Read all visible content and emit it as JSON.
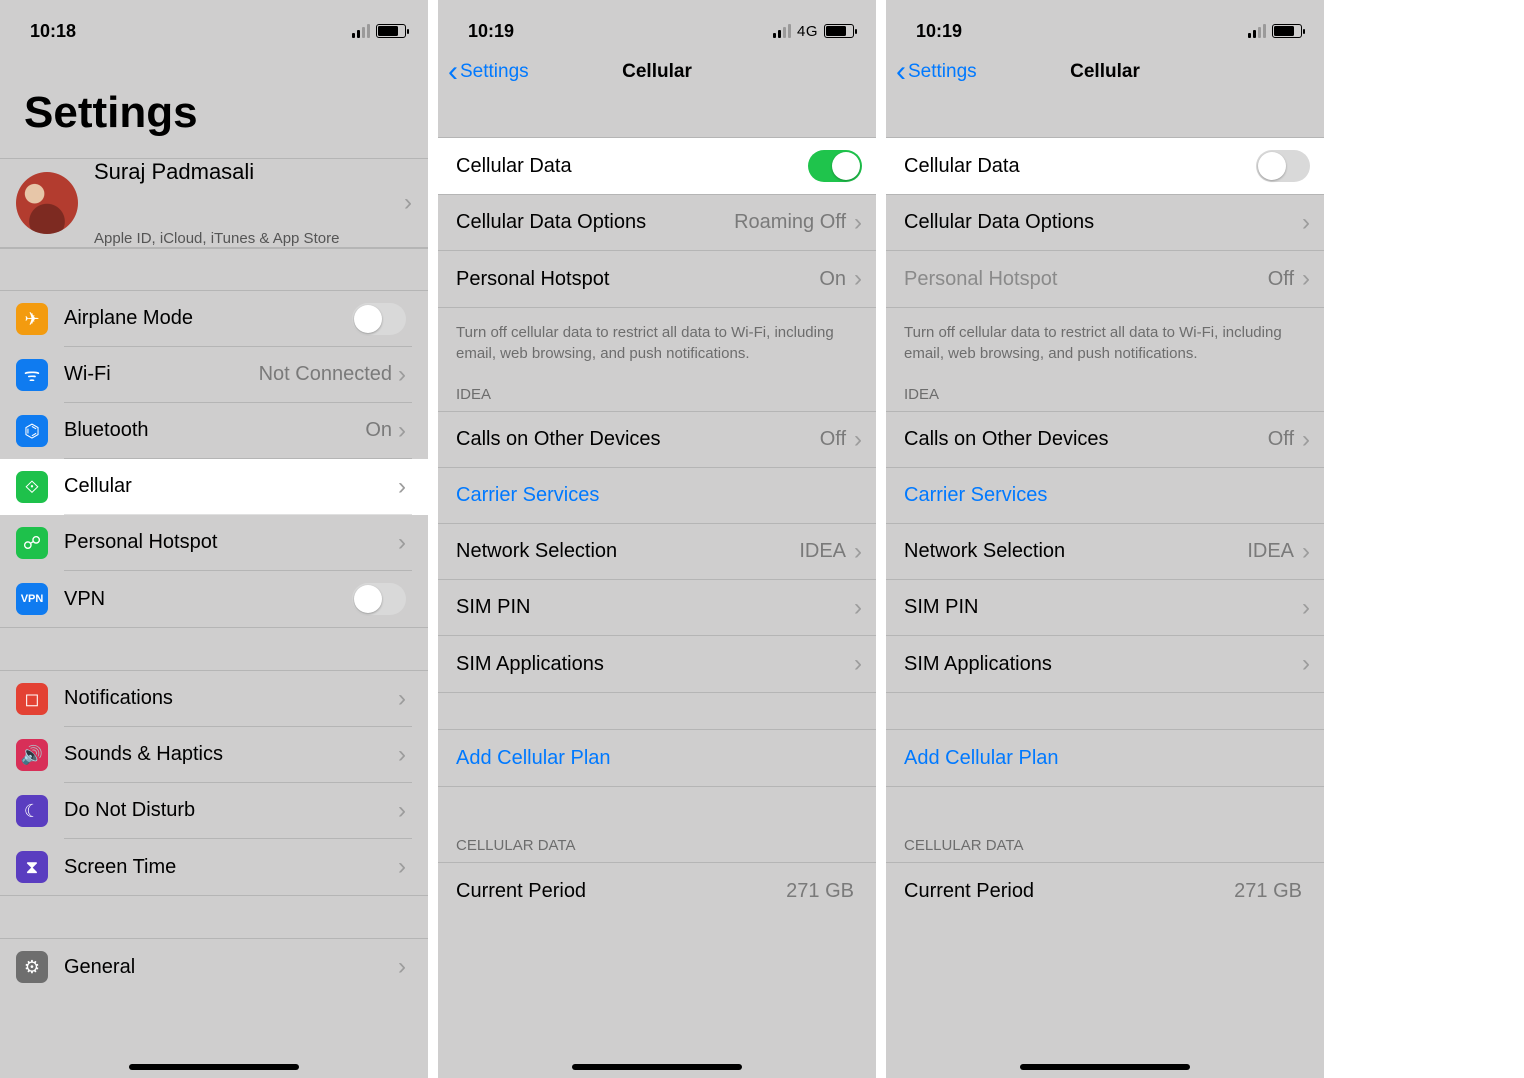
{
  "panel1": {
    "status": {
      "time": "10:18"
    },
    "title": "Settings",
    "profile": {
      "name": "Suraj Padmasali",
      "subtitle": "Apple ID, iCloud, iTunes & App Store"
    },
    "group1": [
      {
        "id": "airplane",
        "label": "Airplane Mode",
        "icon": "airplane-icon",
        "color": "#f39b0f",
        "toggle": false
      },
      {
        "id": "wifi",
        "label": "Wi-Fi",
        "icon": "wifi-icon",
        "color": "#0f7bf0",
        "value": "Not Connected"
      },
      {
        "id": "bluetooth",
        "label": "Bluetooth",
        "icon": "bluetooth-icon",
        "color": "#0f7bf0",
        "value": "On"
      },
      {
        "id": "cellular",
        "label": "Cellular",
        "icon": "cellular-icon",
        "color": "#1ec14b",
        "highlight": true
      },
      {
        "id": "hotspot",
        "label": "Personal Hotspot",
        "icon": "hotspot-icon",
        "color": "#1ec14b"
      },
      {
        "id": "vpn",
        "label": "VPN",
        "icon": "vpn-icon",
        "color": "#0f7bf0",
        "text": "VPN",
        "toggle": false
      }
    ],
    "group2": [
      {
        "id": "notifications",
        "label": "Notifications",
        "icon": "notifications-icon",
        "color": "#e34133"
      },
      {
        "id": "sounds",
        "label": "Sounds & Haptics",
        "icon": "sounds-icon",
        "color": "#d82f58"
      },
      {
        "id": "dnd",
        "label": "Do Not Disturb",
        "icon": "moon-icon",
        "color": "#5a3dc0"
      },
      {
        "id": "screentime",
        "label": "Screen Time",
        "icon": "hourglass-icon",
        "color": "#5a3dc0"
      }
    ],
    "group3": [
      {
        "id": "general",
        "label": "General",
        "icon": "gear-icon",
        "color": "#6e6e6e"
      }
    ]
  },
  "panel2": {
    "status": {
      "time": "10:19",
      "net": "4G"
    },
    "nav": {
      "back": "Settings",
      "title": "Cellular"
    },
    "cellular_data_label": "Cellular Data",
    "cellular_data_on": true,
    "rows1": [
      {
        "label": "Cellular Data Options",
        "value": "Roaming Off"
      },
      {
        "label": "Personal Hotspot",
        "value": "On"
      }
    ],
    "caption": "Turn off cellular data to restrict all data to Wi-Fi, including email, web browsing, and push notifications.",
    "carrier_header": "IDEA",
    "rows2": [
      {
        "label": "Calls on Other Devices",
        "value": "Off"
      },
      {
        "label": "Carrier Services",
        "link": true
      },
      {
        "label": "Network Selection",
        "value": "IDEA"
      },
      {
        "label": "SIM PIN"
      },
      {
        "label": "SIM Applications"
      }
    ],
    "add_plan": "Add Cellular Plan",
    "usage_header": "CELLULAR DATA",
    "current_period_label": "Current Period",
    "current_period_value": "271 GB"
  },
  "panel3": {
    "status": {
      "time": "10:19"
    },
    "nav": {
      "back": "Settings",
      "title": "Cellular"
    },
    "cellular_data_label": "Cellular Data",
    "cellular_data_on": false,
    "rows1": [
      {
        "label": "Cellular Data Options"
      },
      {
        "label": "Personal Hotspot",
        "value": "Off",
        "dim": true
      }
    ],
    "caption": "Turn off cellular data to restrict all data to Wi-Fi, including email, web browsing, and push notifications.",
    "carrier_header": "IDEA",
    "rows2": [
      {
        "label": "Calls on Other Devices",
        "value": "Off"
      },
      {
        "label": "Carrier Services",
        "link": true
      },
      {
        "label": "Network Selection",
        "value": "IDEA"
      },
      {
        "label": "SIM PIN"
      },
      {
        "label": "SIM Applications"
      }
    ],
    "add_plan": "Add Cellular Plan",
    "usage_header": "CELLULAR DATA",
    "current_period_label": "Current Period",
    "current_period_value": "271 GB"
  },
  "icons": {
    "airplane-icon": "✈",
    "wifi-icon": "ᯤ",
    "bluetooth-icon": "⌬",
    "cellular-icon": "⟐",
    "hotspot-icon": "☍",
    "vpn-icon": "VPN",
    "notifications-icon": "◻",
    "sounds-icon": "🔊",
    "moon-icon": "☾",
    "hourglass-icon": "⧗",
    "gear-icon": "⚙"
  }
}
